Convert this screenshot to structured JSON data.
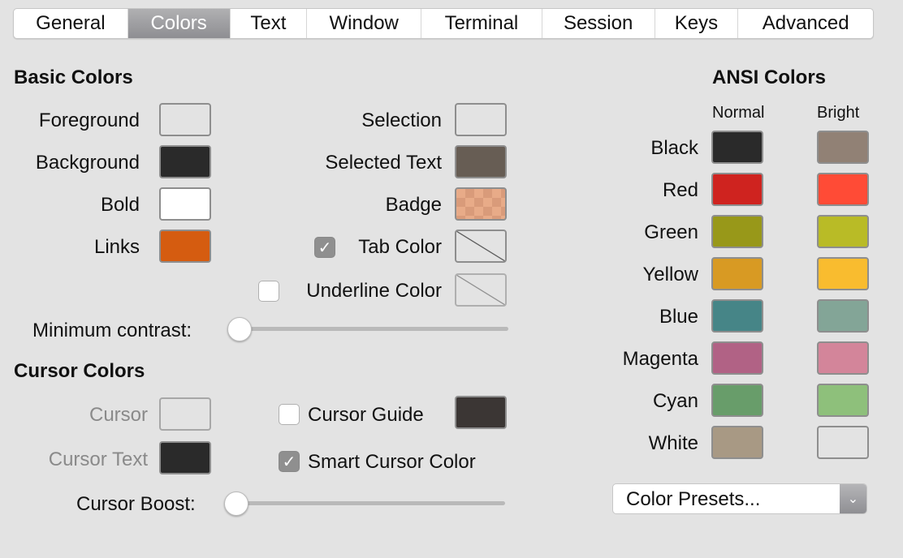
{
  "tabs": [
    "General",
    "Colors",
    "Text",
    "Window",
    "Terminal",
    "Session",
    "Keys",
    "Advanced"
  ],
  "selected_tab": "Colors",
  "basic": {
    "title": "Basic Colors",
    "left": [
      {
        "label": "Foreground",
        "color": "#e3e3e3"
      },
      {
        "label": "Background",
        "color": "#2a2a2a"
      },
      {
        "label": "Bold",
        "color": "#ffffff"
      },
      {
        "label": "Links",
        "color": "#d55c10"
      }
    ],
    "right": [
      {
        "label": "Selection",
        "color": "#e3e3e3"
      },
      {
        "label": "Selected Text",
        "color": "#675d54"
      },
      {
        "label": "Badge",
        "color": "#e8ab88"
      }
    ],
    "tab_color": {
      "label": "Tab Color",
      "checked": true
    },
    "underline_color": {
      "label": "Underline Color",
      "checked": false
    },
    "min_contrast": {
      "label": "Minimum contrast:",
      "value": 0
    }
  },
  "cursor": {
    "title": "Cursor Colors",
    "cursor": {
      "label": "Cursor",
      "color": "#e3e3e3"
    },
    "cursor_text": {
      "label": "Cursor Text",
      "color": "#2a2a2a"
    },
    "cursor_guide": {
      "label": "Cursor Guide",
      "checked": false,
      "color": "#3b3634"
    },
    "smart": {
      "label": "Smart Cursor Color",
      "checked": true
    },
    "boost": {
      "label": "Cursor Boost:",
      "value": 0
    }
  },
  "ansi": {
    "title": "ANSI Colors",
    "normal_label": "Normal",
    "bright_label": "Bright",
    "rows": [
      {
        "name": "Black",
        "normal": "#2a2a2a",
        "bright": "#918175"
      },
      {
        "name": "Red",
        "normal": "#cf231f",
        "bright": "#ff4b36"
      },
      {
        "name": "Green",
        "normal": "#989819",
        "bright": "#b9bb26"
      },
      {
        "name": "Yellow",
        "normal": "#d89a23",
        "bright": "#f9bc2f"
      },
      {
        "name": "Blue",
        "normal": "#468587",
        "bright": "#83a597"
      },
      {
        "name": "Magenta",
        "normal": "#b16285",
        "bright": "#d3859a"
      },
      {
        "name": "Cyan",
        "normal": "#689d6a",
        "bright": "#8ec07b"
      },
      {
        "name": "White",
        "normal": "#a89984",
        "bright": "#e3e3e3"
      }
    ]
  },
  "presets": {
    "label": "Color Presets..."
  }
}
